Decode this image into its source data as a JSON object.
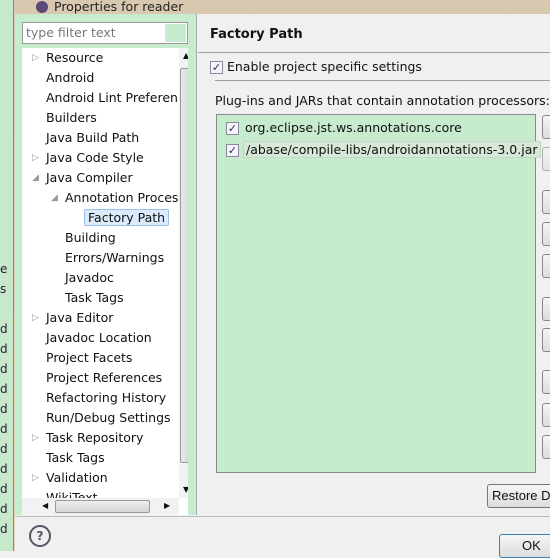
{
  "window": {
    "title": "Properties for reader"
  },
  "background_fragments": [
    "e",
    "s",
    "d",
    "d",
    "d",
    "d",
    "d",
    "d",
    "d",
    "d",
    "d",
    "d",
    "d"
  ],
  "filter": {
    "placeholder": "type filter text"
  },
  "tree": [
    {
      "label": "Resource",
      "level": 0,
      "twisty": "collapsed"
    },
    {
      "label": "Android",
      "level": 0
    },
    {
      "label": "Android Lint Preferen",
      "level": 0
    },
    {
      "label": "Builders",
      "level": 0
    },
    {
      "label": "Java Build Path",
      "level": 0
    },
    {
      "label": "Java Code Style",
      "level": 0,
      "twisty": "collapsed"
    },
    {
      "label": "Java Compiler",
      "level": 0,
      "twisty": "expanded"
    },
    {
      "label": "Annotation Proces",
      "level": 1,
      "twisty": "expanded"
    },
    {
      "label": "Factory Path",
      "level": 2,
      "selected": true
    },
    {
      "label": "Building",
      "level": 1
    },
    {
      "label": "Errors/Warnings",
      "level": 1
    },
    {
      "label": "Javadoc",
      "level": 1
    },
    {
      "label": "Task Tags",
      "level": 1
    },
    {
      "label": "Java Editor",
      "level": 0,
      "twisty": "collapsed"
    },
    {
      "label": "Javadoc Location",
      "level": 0
    },
    {
      "label": "Project Facets",
      "level": 0
    },
    {
      "label": "Project References",
      "level": 0
    },
    {
      "label": "Refactoring History",
      "level": 0
    },
    {
      "label": "Run/Debug Settings",
      "level": 0
    },
    {
      "label": "Task Repository",
      "level": 0,
      "twisty": "collapsed"
    },
    {
      "label": "Task Tags",
      "level": 0
    },
    {
      "label": "Validation",
      "level": 0,
      "twisty": "collapsed"
    },
    {
      "label": "WikiText",
      "level": 0
    }
  ],
  "page": {
    "title": "Factory Path",
    "enable_label": "Enable project specific settings",
    "enable_checked": true,
    "list_label": "Plug-ins and JARs that contain annotation processors:",
    "entries": [
      {
        "label": "org.eclipse.jst.ws.annotations.core",
        "checked": true
      },
      {
        "label": "/abase/compile-libs/androidannotations-3.0.jar",
        "checked": true
      }
    ],
    "restore_label": "Restore D",
    "ok_label": "OK"
  },
  "colors": {
    "pane_bg": "#c7ebcd",
    "selection": "#dcebfc"
  }
}
